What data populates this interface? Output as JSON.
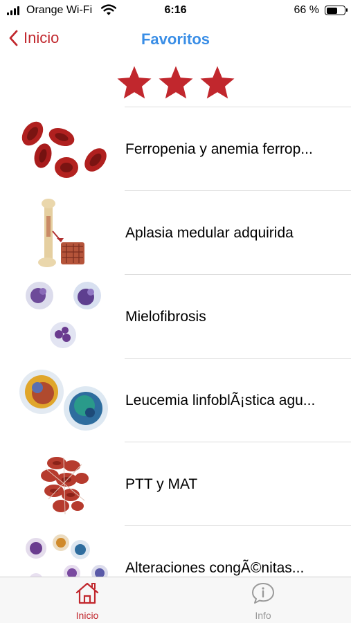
{
  "status_bar": {
    "carrier": "Orange Wi-Fi",
    "time": "6:16",
    "battery_percent": "66 %",
    "battery_level": 0.66
  },
  "nav": {
    "back_label": "Inicio",
    "title": "Favoritos"
  },
  "rating": {
    "stars": 3,
    "color": "#c1272d"
  },
  "items": [
    {
      "label": "Ferropenia y anemia ferrop...",
      "icon": "red-blood-cells"
    },
    {
      "label": "Aplasia medular adquirida",
      "icon": "bone-marrow"
    },
    {
      "label": "Mielofibrosis",
      "icon": "white-blood-cells"
    },
    {
      "label": "Leucemia linfoblÃ¡stica agu...",
      "icon": "lymphoblasts"
    },
    {
      "label": "PTT y MAT",
      "icon": "blood-clot"
    },
    {
      "label": "Alteraciones congÃ©nitas...",
      "icon": "assorted-cells"
    }
  ],
  "tabbar": {
    "home_label": "Inicio",
    "info_label": "Info"
  },
  "colors": {
    "accent_red": "#c1272d",
    "title_blue": "#3a8ee6",
    "inactive_gray": "#9a9a9a"
  }
}
